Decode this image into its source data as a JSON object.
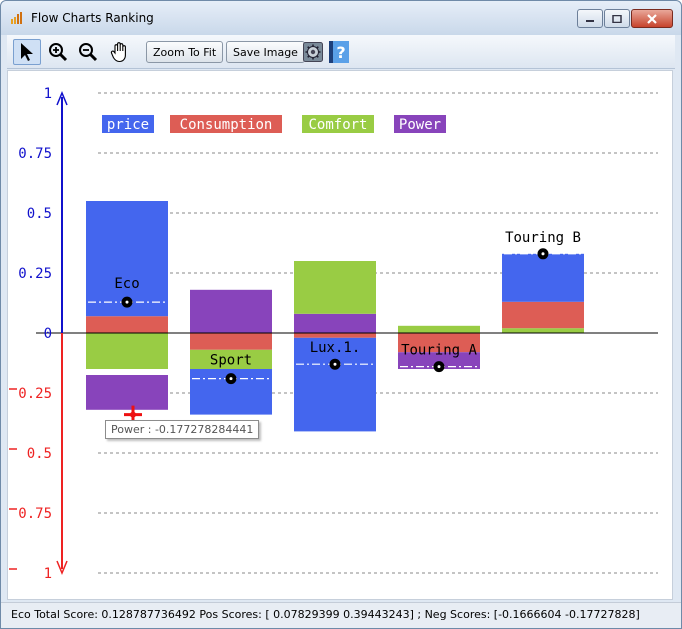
{
  "window": {
    "title": "Flow Charts Ranking",
    "minimize_icon": "minimize-icon",
    "maximize_icon": "maximize-icon",
    "close_icon": "close-icon"
  },
  "toolbar": {
    "tools": [
      {
        "name": "pointer-icon"
      },
      {
        "name": "zoom-in-icon"
      },
      {
        "name": "zoom-out-icon"
      },
      {
        "name": "pan-hand-icon"
      }
    ],
    "zoom_to_fit_label": "Zoom To Fit",
    "save_image_label": "Save Image",
    "settings_icon": "gear-icon",
    "help_icon": "help-icon"
  },
  "colors": {
    "price": "#4466ee",
    "consumption": "#dd5d55",
    "comfort": "#99cc44",
    "power": "#8844bb",
    "pos_axis": "#1111cc",
    "neg_axis": "#ee2222"
  },
  "chart_data": {
    "type": "bar",
    "stacked": true,
    "ylim": [
      -1,
      1
    ],
    "y_ticks": [
      {
        "value": 1,
        "label": "1"
      },
      {
        "value": 0.75,
        "label": "0.75"
      },
      {
        "value": 0.5,
        "label": "0.5"
      },
      {
        "value": 0.25,
        "label": "0.25"
      },
      {
        "value": 0,
        "label": "0"
      },
      {
        "value": -0.25,
        "label": "0.25"
      },
      {
        "value": -0.5,
        "label": "0.5"
      },
      {
        "value": -0.75,
        "label": "0.75"
      },
      {
        "value": -1,
        "label": "1"
      }
    ],
    "grid": true,
    "legend_position": "top-left",
    "legend": [
      {
        "key": "price",
        "label": "price"
      },
      {
        "key": "consumption",
        "label": "Consumption"
      },
      {
        "key": "comfort",
        "label": "Comfort"
      },
      {
        "key": "power",
        "label": "Power"
      }
    ],
    "categories": [
      "Eco",
      "Sport",
      "Lux.1.",
      "Touring A",
      "Touring B"
    ],
    "items": [
      {
        "name": "Eco",
        "total": 0.128787736492,
        "pos": [
          {
            "key": "consumption",
            "value": 0.07
          },
          {
            "key": "price",
            "value": 0.48
          }
        ],
        "neg": [
          {
            "key": "comfort",
            "value": -0.15
          },
          {
            "key": "power",
            "value": -0.17
          }
        ]
      },
      {
        "name": "Sport",
        "total": -0.19,
        "pos": [
          {
            "key": "power",
            "value": 0.18
          }
        ],
        "neg": [
          {
            "key": "consumption",
            "value": -0.07
          },
          {
            "key": "comfort",
            "value": -0.08
          },
          {
            "key": "price",
            "value": -0.19
          }
        ]
      },
      {
        "name": "Lux.1.",
        "total": -0.13,
        "pos": [
          {
            "key": "power",
            "value": 0.08
          },
          {
            "key": "comfort",
            "value": 0.22
          }
        ],
        "neg": [
          {
            "key": "consumption",
            "value": -0.02
          },
          {
            "key": "price",
            "value": -0.39
          }
        ]
      },
      {
        "name": "Touring A",
        "total": -0.14,
        "pos": [
          {
            "key": "comfort",
            "value": 0.03
          }
        ],
        "neg": [
          {
            "key": "consumption",
            "value": -0.08
          },
          {
            "key": "power",
            "value": -0.07
          }
        ]
      },
      {
        "name": "Touring B",
        "total": 0.33,
        "pos": [
          {
            "key": "comfort",
            "value": 0.02
          },
          {
            "key": "consumption",
            "value": 0.11
          },
          {
            "key": "price",
            "value": 0.2
          }
        ],
        "neg": []
      }
    ]
  },
  "tooltip": {
    "text": "Power : -0.177278284441"
  },
  "status": {
    "text": "Eco  Total Score: 0.128787736492  Pos Scores: [ 0.07829399  0.39443243] ; Neg Scores: [-0.1666604  -0.17727828]"
  }
}
